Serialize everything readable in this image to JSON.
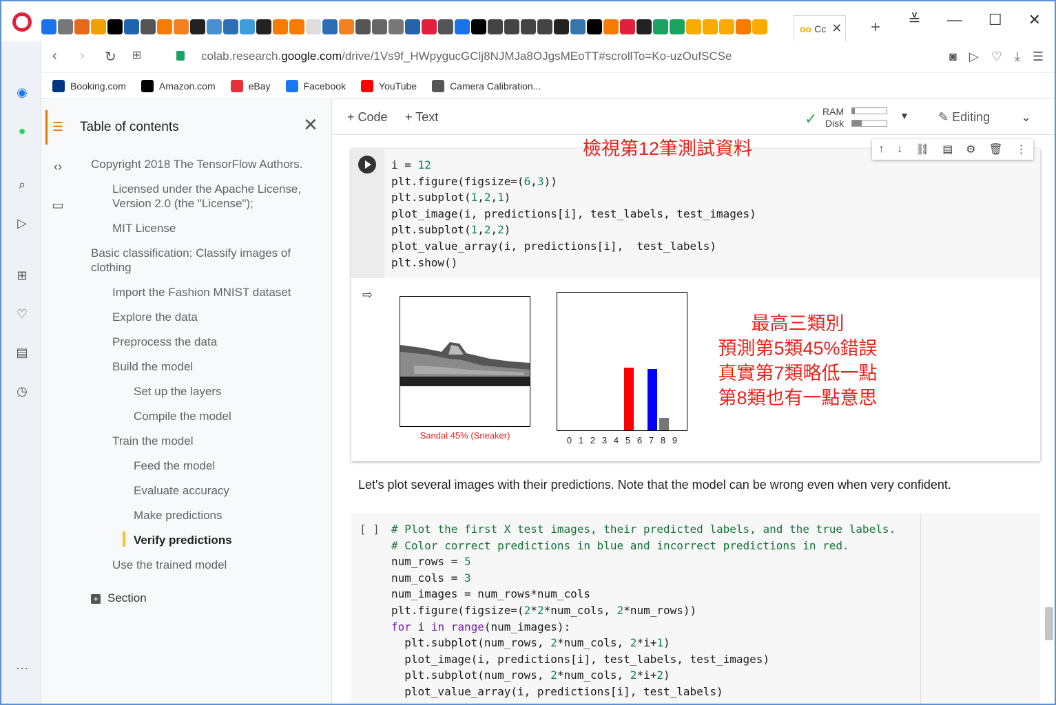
{
  "browser": {
    "active_tab_label": "Cc",
    "url_prefix": "colab.research.",
    "url_domain": "google.com",
    "url_path": "/drive/1Vs9f_HWpygucGClj8NJMJa8OJgsMEoTT#scrollTo=Ko-uzOufSCSe"
  },
  "bookmarks": [
    {
      "label": "Booking.com",
      "icon": "booking-icon",
      "color": "#003580"
    },
    {
      "label": "Amazon.com",
      "icon": "amazon-icon",
      "color": "#000000"
    },
    {
      "label": "eBay",
      "icon": "ebay-icon",
      "color": "#e53238"
    },
    {
      "label": "Facebook",
      "icon": "facebook-icon",
      "color": "#1877f2"
    },
    {
      "label": "YouTube",
      "icon": "youtube-icon",
      "color": "#ff0000"
    },
    {
      "label": "Camera Calibration...",
      "icon": "document-icon",
      "color": "#555555"
    }
  ],
  "toc": {
    "title": "Table of contents",
    "items": [
      {
        "label": "Copyright 2018 The TensorFlow Authors.",
        "level": 1
      },
      {
        "label": "Licensed under the Apache License, Version 2.0 (the \"License\");",
        "level": 2
      },
      {
        "label": "MIT License",
        "level": 2
      },
      {
        "label": "Basic classification: Classify images of clothing",
        "level": 1
      },
      {
        "label": "Import the Fashion MNIST dataset",
        "level": 2
      },
      {
        "label": "Explore the data",
        "level": 2
      },
      {
        "label": "Preprocess the data",
        "level": 2
      },
      {
        "label": "Build the model",
        "level": 2
      },
      {
        "label": "Set up the layers",
        "level": 3
      },
      {
        "label": "Compile the model",
        "level": 3
      },
      {
        "label": "Train the model",
        "level": 2
      },
      {
        "label": "Feed the model",
        "level": 3
      },
      {
        "label": "Evaluate accuracy",
        "level": 3
      },
      {
        "label": "Make predictions",
        "level": 3
      },
      {
        "label": "Verify predictions",
        "level": 3,
        "active": true
      },
      {
        "label": "Use the trained model",
        "level": 2
      }
    ],
    "section_label": "Section"
  },
  "toolbar": {
    "code_label": "+ Code",
    "text_label": "+ Text",
    "ram_label": "RAM",
    "disk_label": "Disk",
    "ram_usage": 0.08,
    "disk_usage": 0.28,
    "editing_label": "Editing"
  },
  "cell1": {
    "annotation_title": "檢視第12筆測試資料",
    "code": [
      "i = 12",
      "plt.figure(figsize=(6,3))",
      "plt.subplot(1,2,1)",
      "plot_image(i, predictions[i], test_labels, test_images)",
      "plt.subplot(1,2,2)",
      "plot_value_array(i, predictions[i],  test_labels)",
      "plt.show()"
    ],
    "prediction_label": "Sandal 45% (Sneaker)",
    "output_annotation": [
      "最高三類別",
      "預測第5類45%錯誤",
      "真實第7類略低一點",
      "第8類也有一點意思"
    ]
  },
  "chart_data": {
    "type": "bar",
    "categories": [
      "0",
      "1",
      "2",
      "3",
      "4",
      "5",
      "6",
      "7",
      "8",
      "9"
    ],
    "values": [
      0,
      0,
      0,
      0,
      0,
      0.45,
      0,
      0.44,
      0.09,
      0
    ],
    "colors": [
      "#777777",
      "#777777",
      "#777777",
      "#777777",
      "#777777",
      "#ff0000",
      "#777777",
      "#0000ff",
      "#777777",
      "#777777"
    ],
    "ylim": [
      0,
      1
    ]
  },
  "markdown_text": "Let's plot several images with their predictions. Note that the model can be wrong even when very confident.",
  "cell2": {
    "brackets": "[ ]",
    "code": [
      "# Plot the first X test images, their predicted labels, and the true labels.",
      "# Color correct predictions in blue and incorrect predictions in red.",
      "num_rows = 5",
      "num_cols = 3",
      "num_images = num_rows*num_cols",
      "plt.figure(figsize=(2*2*num_cols, 2*num_rows))",
      "for i in range(num_images):",
      "  plt.subplot(num_rows, 2*num_cols, 2*i+1)",
      "  plot_image(i, predictions[i], test_labels, test_images)",
      "  plt.subplot(num_rows, 2*num_cols, 2*i+2)",
      "  plot_value_array(i, predictions[i], test_labels)"
    ]
  }
}
